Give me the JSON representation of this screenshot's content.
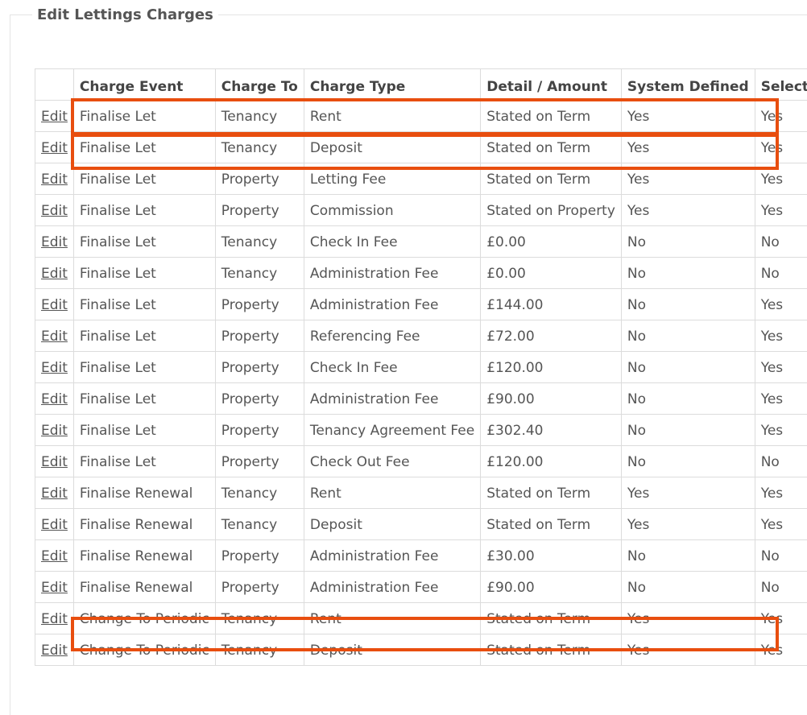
{
  "section": {
    "title": "Edit Lettings Charges"
  },
  "table": {
    "headers": [
      "",
      "Charge Event",
      "Charge To",
      "Charge Type",
      "Detail / Amount",
      "System Defined",
      "Selected"
    ],
    "edit_label": "Edit",
    "rows": [
      [
        "Finalise Let",
        "Tenancy",
        "Rent",
        "Stated on Term",
        "Yes",
        "Yes"
      ],
      [
        "Finalise Let",
        "Tenancy",
        "Deposit",
        "Stated on Term",
        "Yes",
        "Yes"
      ],
      [
        "Finalise Let",
        "Property",
        "Letting Fee",
        "Stated on Term",
        "Yes",
        "Yes"
      ],
      [
        "Finalise Let",
        "Property",
        "Commission",
        "Stated on Property",
        "Yes",
        "Yes"
      ],
      [
        "Finalise Let",
        "Tenancy",
        "Check In Fee",
        "£0.00",
        "No",
        "No"
      ],
      [
        "Finalise Let",
        "Tenancy",
        "Administration Fee",
        "£0.00",
        "No",
        "No"
      ],
      [
        "Finalise Let",
        "Property",
        "Administration Fee",
        "£144.00",
        "No",
        "Yes"
      ],
      [
        "Finalise Let",
        "Property",
        "Referencing Fee",
        "£72.00",
        "No",
        "Yes"
      ],
      [
        "Finalise Let",
        "Property",
        "Check In Fee",
        "£120.00",
        "No",
        "Yes"
      ],
      [
        "Finalise Let",
        "Property",
        "Administration Fee",
        "£90.00",
        "No",
        "Yes"
      ],
      [
        "Finalise Let",
        "Property",
        "Tenancy Agreement Fee",
        "£302.40",
        "No",
        "Yes"
      ],
      [
        "Finalise Let",
        "Property",
        "Check Out Fee",
        "£120.00",
        "No",
        "No"
      ],
      [
        "Finalise Renewal",
        "Tenancy",
        "Rent",
        "Stated on Term",
        "Yes",
        "Yes"
      ],
      [
        "Finalise Renewal",
        "Tenancy",
        "Deposit",
        "Stated on Term",
        "Yes",
        "Yes"
      ],
      [
        "Finalise Renewal",
        "Property",
        "Administration Fee",
        "£30.00",
        "No",
        "No"
      ],
      [
        "Finalise Renewal",
        "Property",
        "Administration Fee",
        "£90.00",
        "No",
        "No"
      ],
      [
        "Change To Periodic",
        "Tenancy",
        "Rent",
        "Stated on Term",
        "Yes",
        "Yes"
      ],
      [
        "Change To Periodic",
        "Tenancy",
        "Deposit",
        "Stated on Term",
        "Yes",
        "Yes"
      ]
    ]
  },
  "colors": {
    "highlight": "#e84e0f",
    "border": "#dcdcdc",
    "text": "#555555"
  }
}
